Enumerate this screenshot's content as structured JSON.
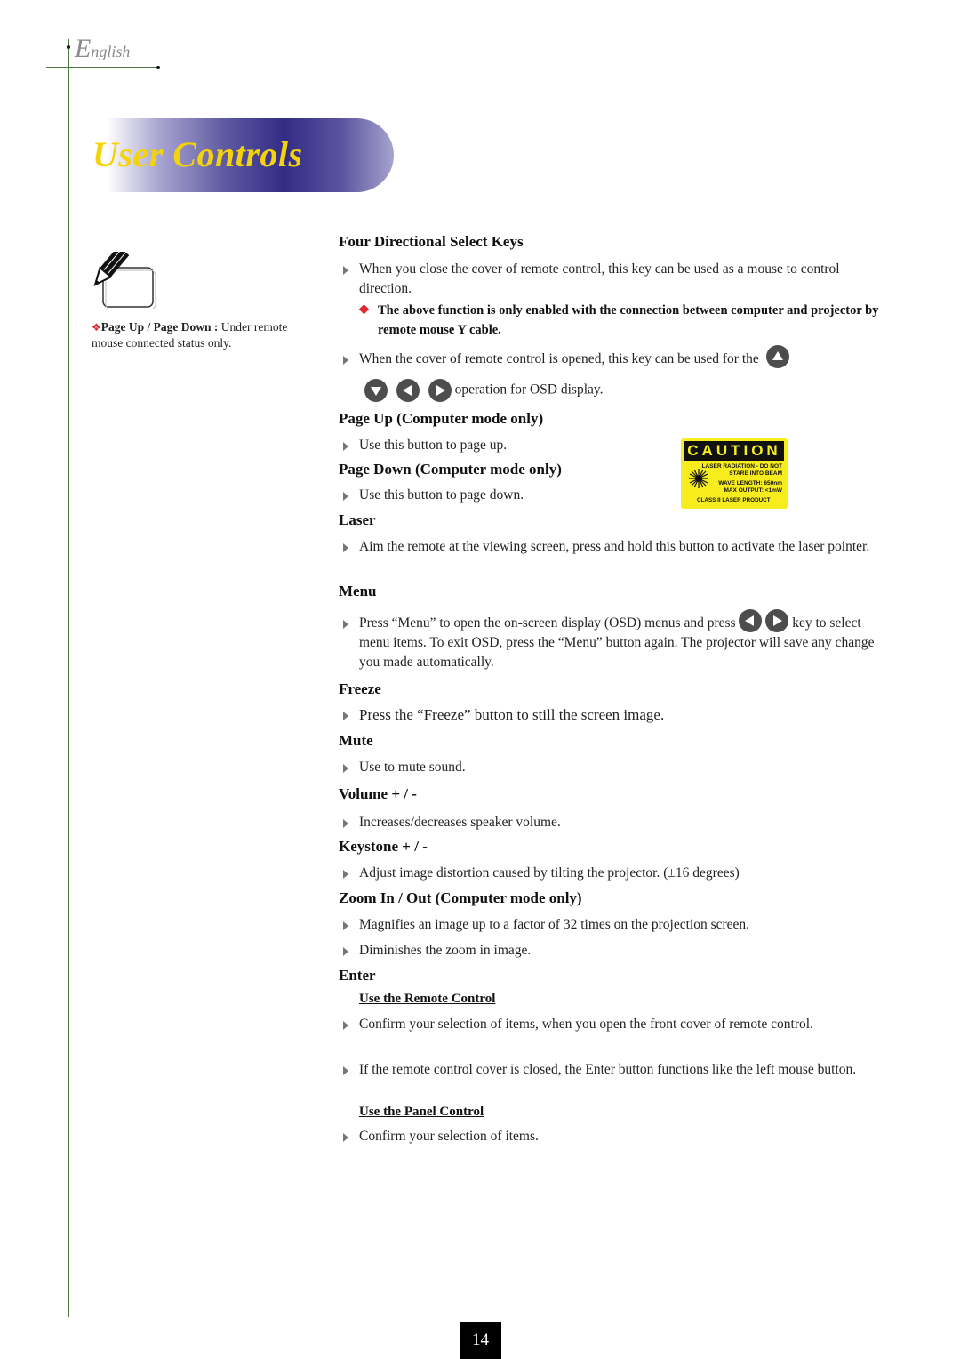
{
  "header": {
    "language_initial": "E",
    "language_rest": "nglish",
    "title": "User Controls"
  },
  "side_note": {
    "icon": "pencil-note-icon",
    "bold": "Page Up / Page Down :",
    "text": " Under remote mouse connected status only."
  },
  "sections": {
    "four_dir": {
      "heading": "Four Directional Select Keys",
      "bullet1": "When you close the cover of remote control, this key can be used as a mouse to control direction.",
      "warning": "The above function is only enabled with the connection between computer and projector by remote mouse Y cable.",
      "bullet2_a": "When the cover of remote control is opened, this key can be used for the",
      "bullet2_b": "operation for OSD display.",
      "key_icons": [
        "up-arrow-key-icon",
        "down-arrow-key-icon",
        "left-arrow-key-icon",
        "right-arrow-key-icon"
      ]
    },
    "page_up": {
      "heading": "Page Up (Computer mode only)",
      "bullet": "Use this button to page up."
    },
    "page_down": {
      "heading": "Page Down (Computer mode only)",
      "bullet": "Use this button to page down."
    },
    "laser": {
      "heading": "Laser",
      "bullet": "Aim the remote at the viewing screen, press and hold this button to activate the laser pointer."
    },
    "menu": {
      "heading": "Menu",
      "bullet_a": "Press “Menu”  to open the on-screen display (OSD) menus and press",
      "bullet_b": "key to select menu items. To exit OSD, press the “Menu” button again. The projector will save any change you made automatically."
    },
    "freeze": {
      "heading": "Freeze",
      "bullet": "Press the “Freeze” button to still the screen image."
    },
    "mute": {
      "heading": "Mute",
      "bullet": "Use to mute sound."
    },
    "volume": {
      "heading": "Volume + / -",
      "bullet": "Increases/decreases speaker volume."
    },
    "keystone": {
      "heading": "Keystone + / -",
      "bullet": "Adjust image distortion caused by tilting the projector. (±16 degrees)"
    },
    "zoom": {
      "heading": "Zoom In / Out (Computer mode only)",
      "bullet1": "Magnifies an image up to a factor of 32 times on the projection screen.",
      "bullet2": "Diminishes the zoom in image."
    },
    "enter": {
      "heading": "Enter",
      "sub1": "Use the Remote Control",
      "bullet1": "Confirm your selection of items, when you open the front cover of remote control.",
      "bullet2": "If the remote control cover is closed, the Enter button functions like the left mouse button.",
      "sub2": "Use the Panel Control",
      "bullet3": "Confirm your selection of items."
    }
  },
  "caution_label": {
    "title": "CAUTION",
    "line1a": "LASER RADIATION - DO NOT",
    "line1b": "STARE INTO BEAM",
    "line2a": "WAVE LENGTH: 650nm",
    "line2b": "MAX OUTPUT: <1mW",
    "line3": "CLASS II LASER PRODUCT",
    "colors": {
      "background": "#f7ec1d",
      "text": "#111111"
    }
  },
  "footer": {
    "page_number": "14"
  },
  "colors": {
    "title_text": "#f4d30c",
    "banner_dark": "#322c86",
    "frame_line": "#4a7a3e",
    "note_diamond": "#e0262a"
  }
}
